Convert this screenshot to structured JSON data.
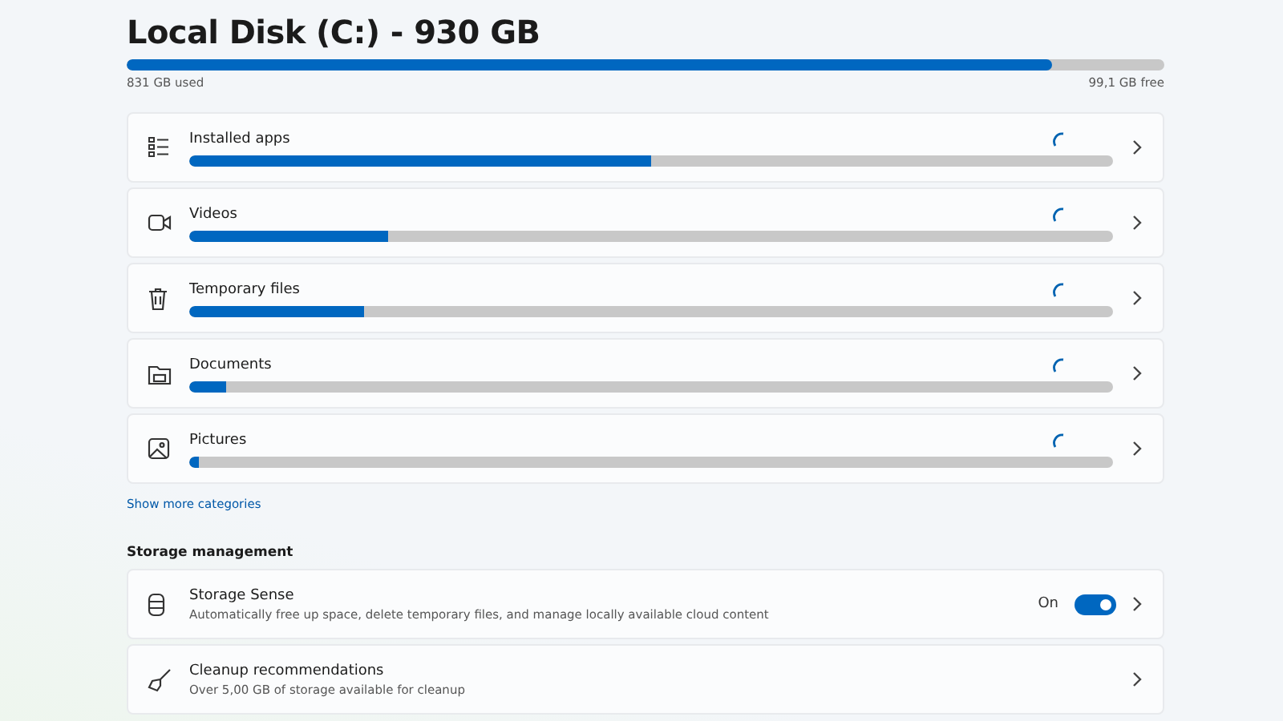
{
  "disk": {
    "title": "Local Disk (C:) - 930 GB",
    "level": 0.892,
    "used": "831 GB used",
    "free": "99,1 GB free"
  },
  "categories": [
    {
      "kind": "apps",
      "label": "Installed apps",
      "level": 0.5,
      "loading": true
    },
    {
      "kind": "videos",
      "label": "Videos",
      "level": 0.215,
      "loading": true
    },
    {
      "kind": "temp",
      "label": "Temporary files",
      "level": 0.19,
      "loading": true
    },
    {
      "kind": "documents",
      "label": "Documents",
      "level": 0.04,
      "loading": true
    },
    {
      "kind": "pictures",
      "label": "Pictures",
      "level": 0.01,
      "loading": true
    }
  ],
  "show_more": "Show more categories",
  "storage_management": {
    "heading": "Storage management",
    "items": [
      {
        "kind": "sense",
        "title": "Storage Sense",
        "description": "Automatically free up space, delete temporary files, and manage locally available cloud content",
        "toggle": {
          "label": "On",
          "on": true
        }
      },
      {
        "kind": "cleanup",
        "title": "Cleanup recommendations",
        "description": "Over 5,00 GB of storage available for cleanup"
      }
    ]
  }
}
